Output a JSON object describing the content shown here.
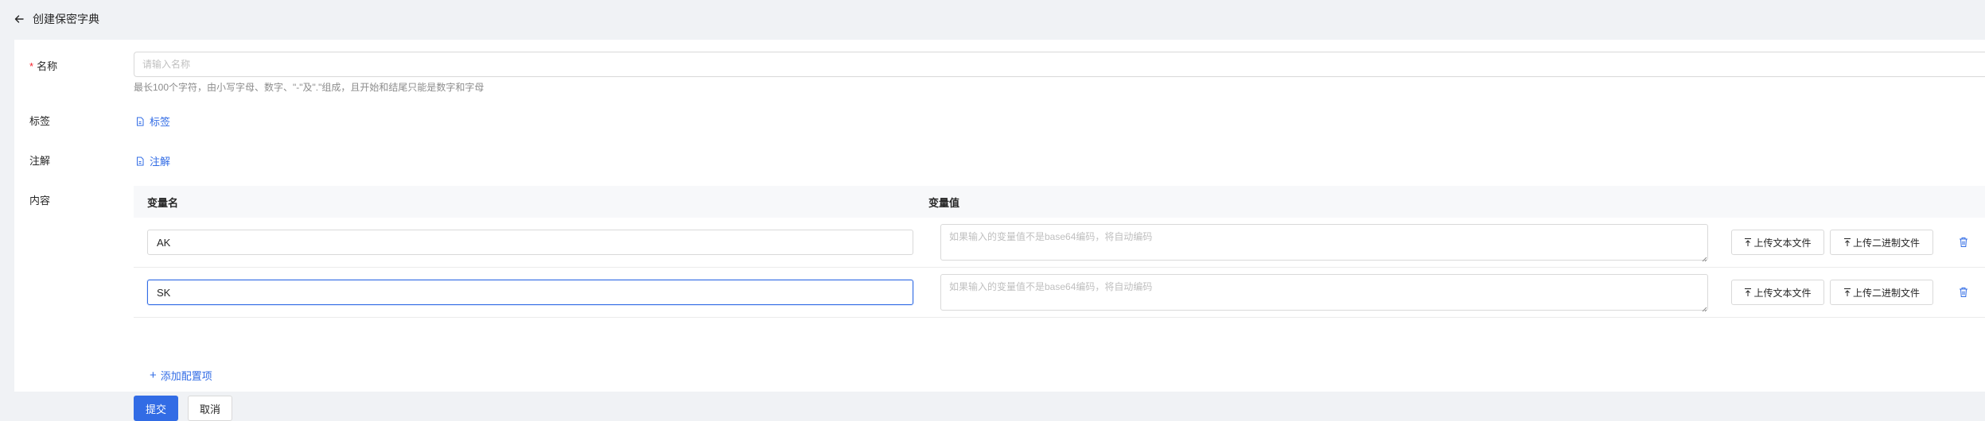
{
  "header": {
    "title": "创建保密字典"
  },
  "form": {
    "name": {
      "label": "名称",
      "required_mark": "*",
      "placeholder": "请输入名称",
      "value": "",
      "hint": "最长100个字符，由小写字母、数字、\"-\"及\".\"组成，且开始和结尾只能是数字和字母"
    },
    "tags": {
      "label": "标签",
      "link": "标签"
    },
    "annotations": {
      "label": "注解",
      "link": "注解"
    },
    "content": {
      "label": "内容",
      "columns": {
        "key": "变量名",
        "value": "变量值"
      },
      "value_placeholder": "如果输入的变量值不是base64编码，将自动编码",
      "upload_text_label": "上传文本文件",
      "upload_binary_label": "上传二进制文件",
      "rows": [
        {
          "key": "AK",
          "value": ""
        },
        {
          "key": "SK",
          "value": ""
        }
      ],
      "add_label": "添加配置项"
    }
  },
  "actions": {
    "submit": "提交",
    "cancel": "取消"
  },
  "colors": {
    "primary": "#326ce5",
    "required": "#f5222d",
    "background": "#f0f2f5"
  },
  "icons": {
    "back": "arrow-left-icon",
    "tag": "file-icon",
    "upload": "upload-icon",
    "delete": "trash-icon",
    "add": "plus-icon"
  }
}
